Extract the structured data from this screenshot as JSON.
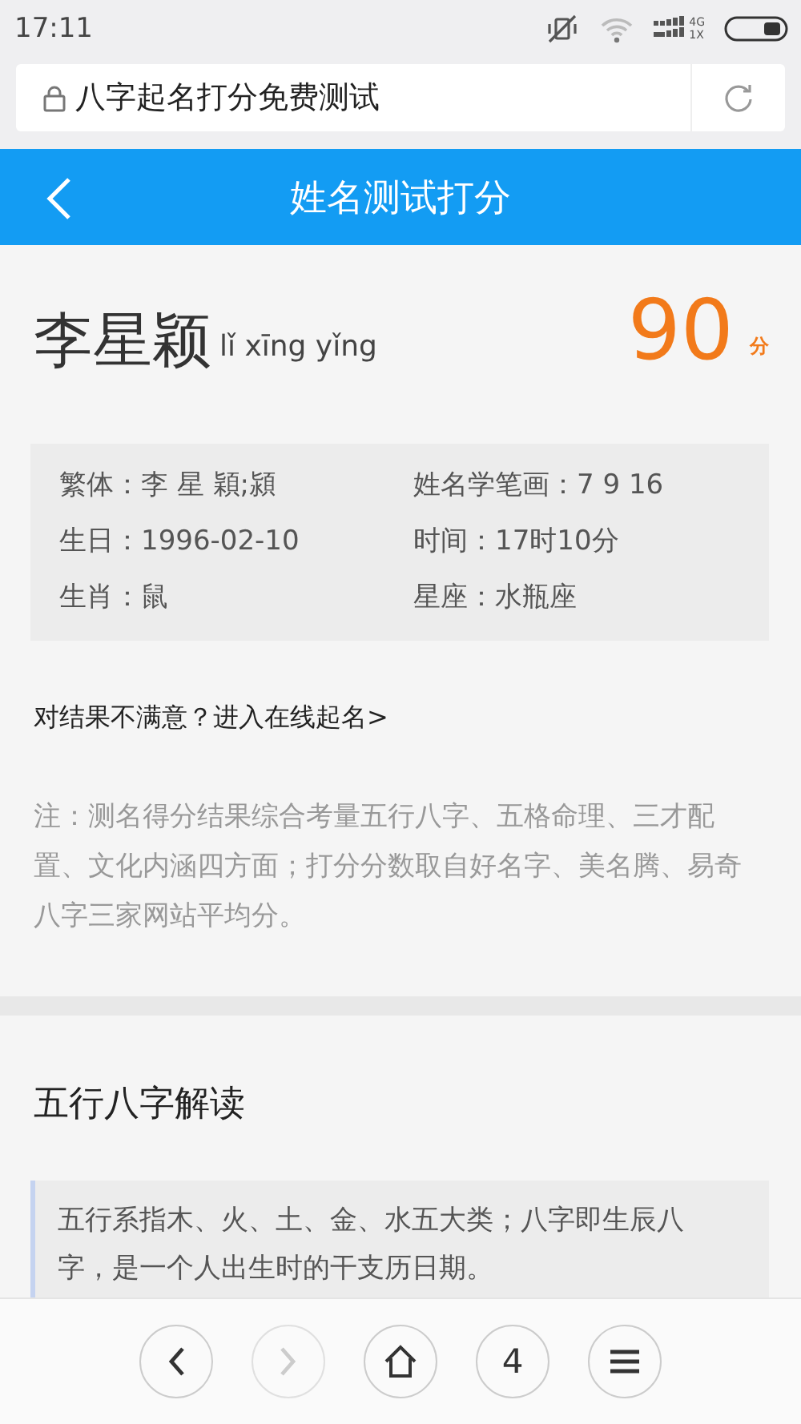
{
  "status_bar": {
    "time": "17:11",
    "network_top": "4G",
    "network_bottom": "1X"
  },
  "address_bar": {
    "title": "八字起名打分免费测试"
  },
  "header": {
    "title": "姓名测试打分"
  },
  "result": {
    "name": "李星颖",
    "pinyin": "lǐ xīng yǐng",
    "score": "90",
    "score_unit": "分"
  },
  "details": [
    {
      "label": "繁体：",
      "value": "李 星 穎;潁"
    },
    {
      "label": "姓名学笔画：",
      "value": "7 9 16"
    },
    {
      "label": "生日：",
      "value": "1996-02-10"
    },
    {
      "label": "时间：",
      "value": "17时10分"
    },
    {
      "label": "生肖：",
      "value": "鼠"
    },
    {
      "label": "星座：",
      "value": "水瓶座"
    }
  ],
  "link": "对结果不满意？进入在线起名>",
  "note": "注：测名得分结果综合考量五行八字、五格命理、三才配置、文化内涵四方面；打分分数取自好名字、美名腾、易奇八字三家网站平均分。",
  "section": {
    "title": "五行八字解读",
    "quote": "五行系指木、火、土、金、水五大类；八字即生辰八字，是一个人出生时的干支历日期。"
  },
  "bottom_nav": [
    {
      "kind": "back",
      "disabled": false
    },
    {
      "kind": "forward",
      "disabled": true
    },
    {
      "kind": "home",
      "disabled": false
    },
    {
      "kind": "tabs",
      "label": "4",
      "disabled": false
    },
    {
      "kind": "menu",
      "disabled": false
    }
  ]
}
